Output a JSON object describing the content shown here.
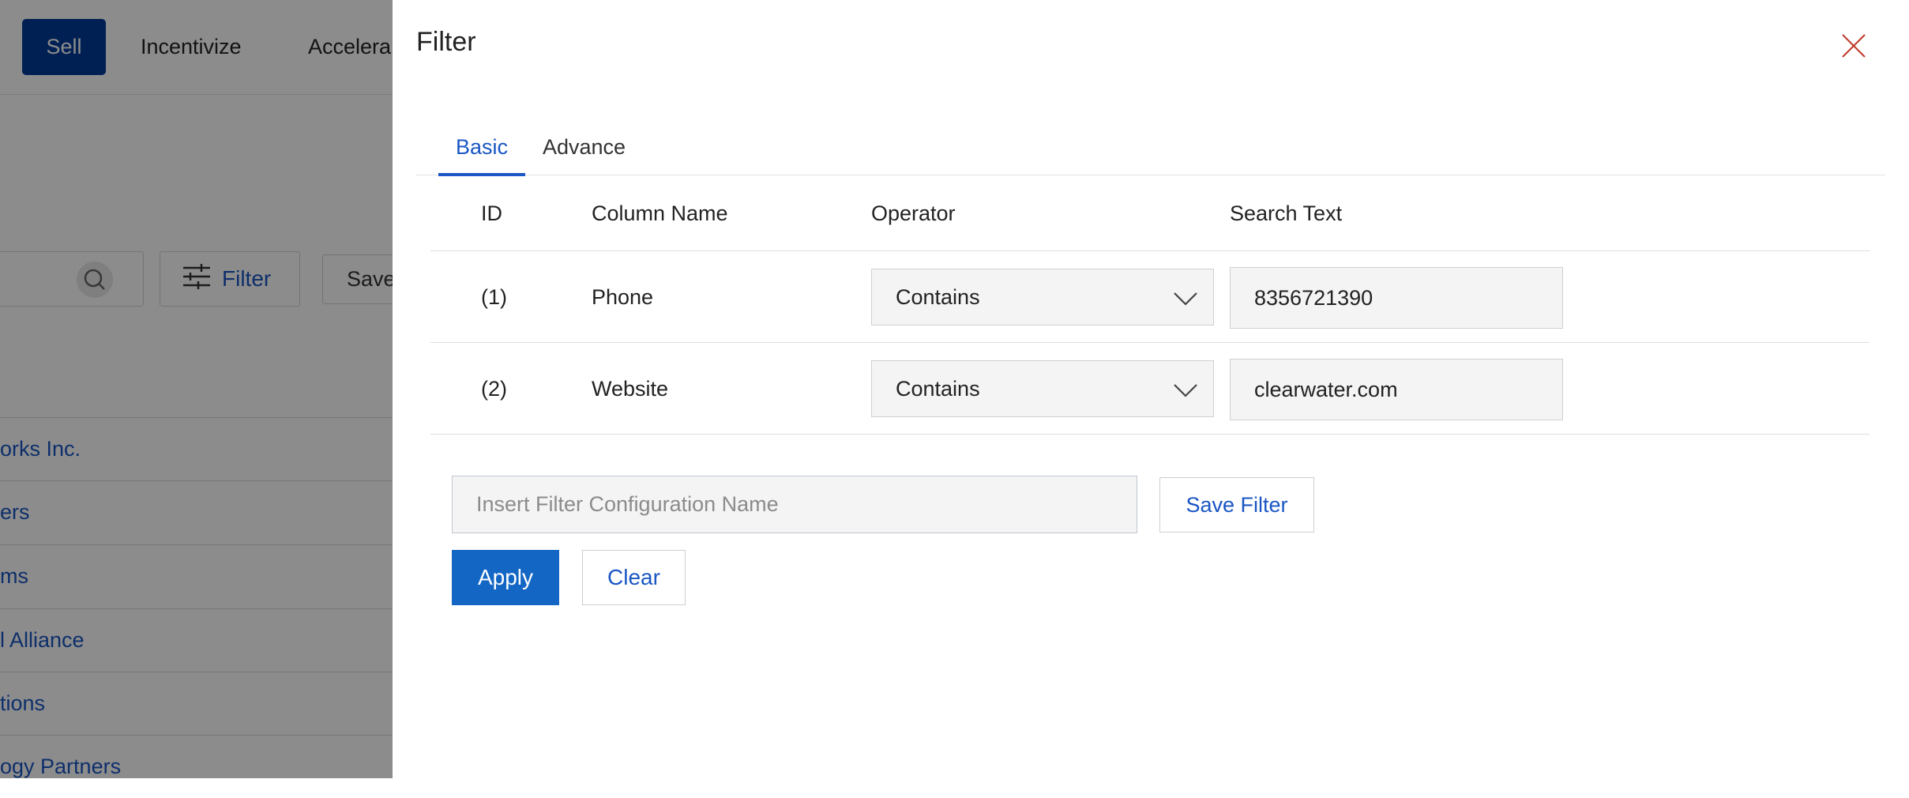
{
  "background": {
    "nav": {
      "sell": "Sell",
      "incentivize": "Incentivize",
      "accelerate": "Accelera"
    },
    "toolbar": {
      "filter_label": "Filter",
      "save_label": "Save"
    },
    "rows": [
      "orks Inc.",
      "ers",
      "ms",
      "l Alliance",
      "tions",
      "ogy Partners"
    ]
  },
  "drawer": {
    "title": "Filter",
    "tabs": [
      {
        "label": "Basic",
        "active": true
      },
      {
        "label": "Advance",
        "active": false
      }
    ],
    "table": {
      "headers": {
        "id": "ID",
        "column_name": "Column Name",
        "operator": "Operator",
        "search_text": "Search Text"
      },
      "rows": [
        {
          "id": "(1)",
          "column_name": "Phone",
          "operator": "Contains",
          "search_text": "8356721390"
        },
        {
          "id": "(2)",
          "column_name": "Website",
          "operator": "Contains",
          "search_text": "clearwater.com"
        }
      ]
    },
    "config_placeholder": "Insert Filter Configuration Name",
    "save_filter_label": "Save Filter",
    "apply_label": "Apply",
    "clear_label": "Clear"
  },
  "colors": {
    "primary": "#1366c4",
    "nav_active": "#003b99",
    "link": "#1a56c4",
    "close": "#c0392b",
    "overlay": "rgba(0,0,0,0.45)"
  }
}
